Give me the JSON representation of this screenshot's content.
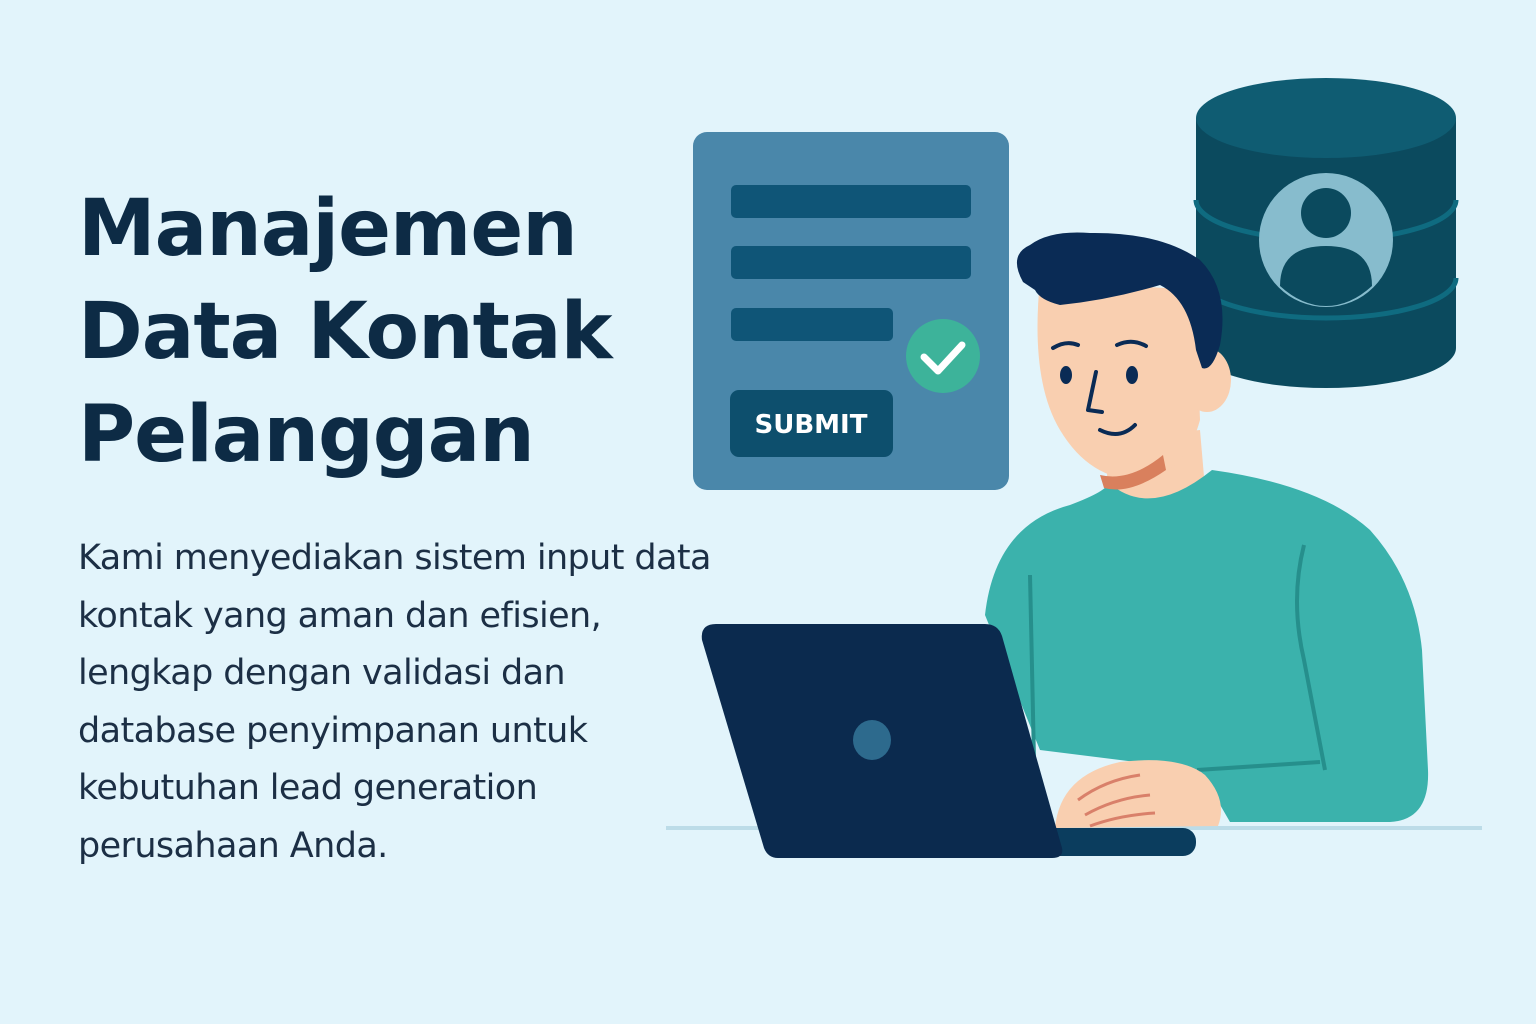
{
  "headline": {
    "line1": "Manajemen",
    "line2": "Data Kontak",
    "line3": "Pelanggan"
  },
  "description": {
    "line1": "Kami menyediakan sistem input data",
    "line2": "kontak yang aman dan efisien,",
    "line3": "lengkap dengan validasi dan",
    "line4": "database penyimpanan untuk",
    "line5": "kebutuhan lead generation",
    "line6": "perusahaan Anda."
  },
  "form_card": {
    "submit_label": "SUBMIT",
    "check_icon": "check-icon"
  },
  "database": {
    "icon": "user-icon"
  },
  "colors": {
    "background": "#e2f4fb",
    "heading": "#0d2b45",
    "form_card": "#4a87aa",
    "form_field": "#0f5577",
    "check": "#3db39a",
    "database": "#0b4a5e",
    "shirt": "#3bb2ac",
    "laptop": "#0b2a4e"
  }
}
